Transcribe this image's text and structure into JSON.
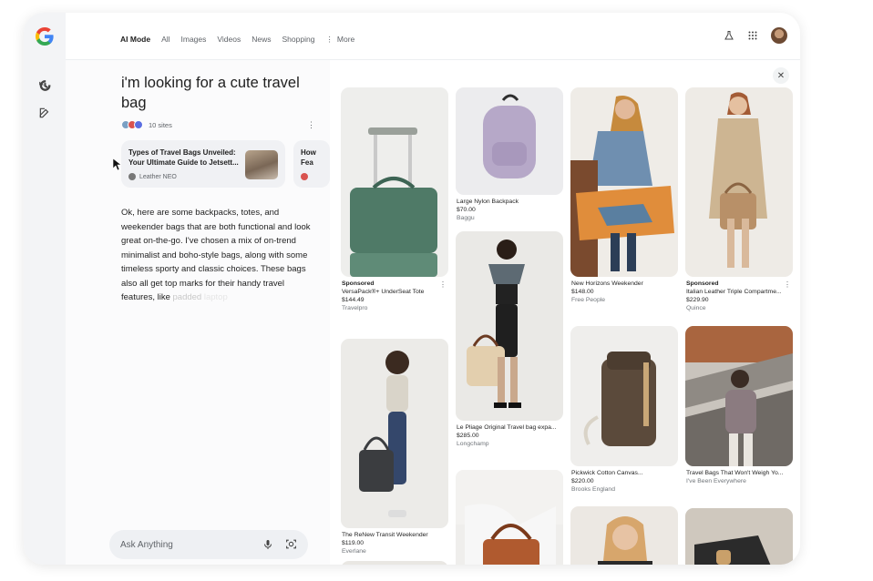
{
  "nav": {
    "tabs": [
      {
        "label": "AI Mode",
        "active": true
      },
      {
        "label": "All"
      },
      {
        "label": "Images"
      },
      {
        "label": "Videos"
      },
      {
        "label": "News"
      },
      {
        "label": "Shopping"
      },
      {
        "label": "More"
      }
    ],
    "icons": [
      "labs-flask-icon",
      "apps-grid-icon",
      "avatar"
    ]
  },
  "rail": {
    "icons": [
      "google-logo",
      "history-icon",
      "new-chat-icon"
    ]
  },
  "chat": {
    "query": "i'm looking for a cute travel bag",
    "sites_count": "10 sites",
    "sources": [
      {
        "title": "Types of Travel Bags Unveiled: Your Ultimate Guide to Jetsett...",
        "site": "Leather NEO"
      },
      {
        "title": "How",
        "title2": "Fea",
        "site": ""
      }
    ],
    "answer_main": "Ok, here are some backpacks, totes, and weekender bags that are both functional and look great on-the-go. I've chosen a mix of on-trend minimalist and boho-style bags, along with some timeless sporty and classic choices. These bags also all get top marks for their handy travel features, like",
    "answer_fade": " padded",
    "answer_fade2": " laptop",
    "ask_placeholder": "Ask Anything"
  },
  "gallery": {
    "products": [
      {
        "sponsored": "Sponsored",
        "title": "VersaPack®+ UnderSeat Tote",
        "price": "$144.49",
        "store": "Travelpro"
      },
      {
        "sponsored": "",
        "title": "Large Nylon Backpack",
        "price": "$70.00",
        "store": "Baggu"
      },
      {
        "sponsored": "",
        "title": "New Horizons Weekender",
        "price": "$148.00",
        "store": "Free People"
      },
      {
        "sponsored": "Sponsored",
        "title": "Italian Leather Triple Compartme...",
        "price": "$229.90",
        "store": "Quince"
      },
      {
        "sponsored": "",
        "title": "The ReNew Transit Weekender",
        "price": "$119.00",
        "store": "Everlane"
      },
      {
        "sponsored": "",
        "title": "Le Pliage Original Travel bag expa...",
        "price": "$285.00",
        "store": "Longchamp"
      },
      {
        "sponsored": "",
        "title": "Pickwick Cotton Canvas...",
        "price": "$220.00",
        "store": "Brooks England"
      },
      {
        "sponsored": "",
        "title": "Travel Bags That Won't Weigh Yo...",
        "price": "",
        "store": "I've Been Everywhere"
      }
    ]
  },
  "colors": {
    "accent": "#1a73e8",
    "panel": "#f3f4f6",
    "chip": "#eef0f3"
  }
}
